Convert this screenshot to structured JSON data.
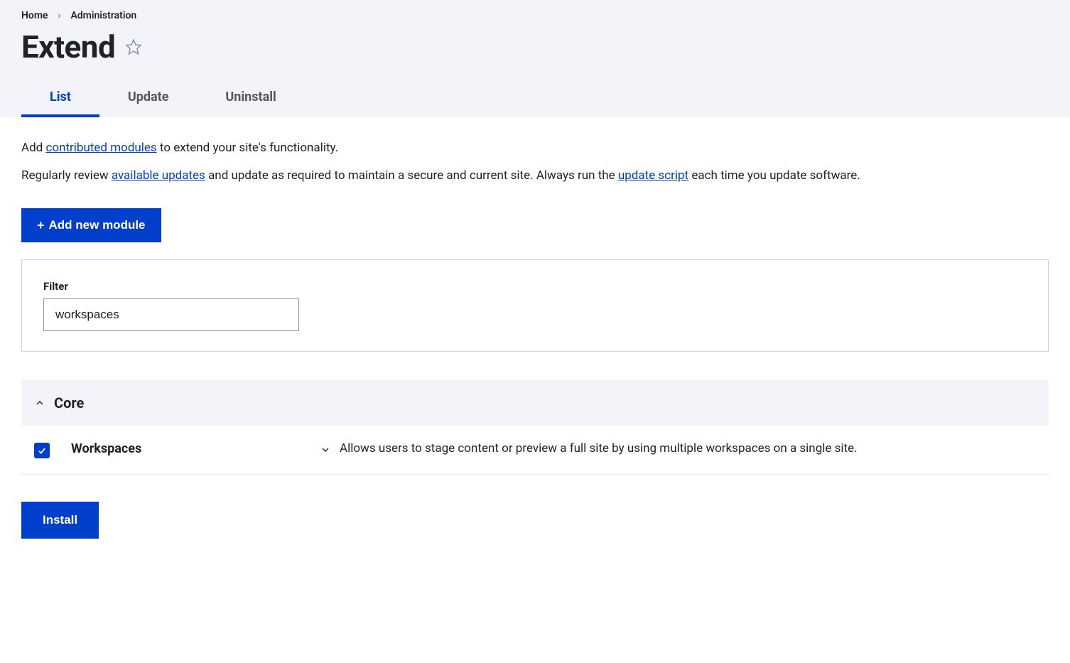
{
  "breadcrumb": {
    "home": "Home",
    "admin": "Administration"
  },
  "page_title": "Extend",
  "tabs": {
    "list": "List",
    "update": "Update",
    "uninstall": "Uninstall"
  },
  "intro": {
    "line1_prefix": "Add ",
    "line1_link": "contributed modules",
    "line1_suffix": " to extend your site's functionality.",
    "line2_prefix": "Regularly review ",
    "line2_link1": "available updates",
    "line2_mid": " and update as required to maintain a secure and current site. Always run the ",
    "line2_link2": "update script",
    "line2_suffix": " each time you update software."
  },
  "buttons": {
    "add_module": "Add new module",
    "install": "Install"
  },
  "filter": {
    "label": "Filter",
    "value": "workspaces"
  },
  "category": {
    "title": "Core"
  },
  "modules": [
    {
      "name": "Workspaces",
      "checked": true,
      "description": "Allows users to stage content or preview a full site by using multiple workspaces on a single site."
    }
  ]
}
